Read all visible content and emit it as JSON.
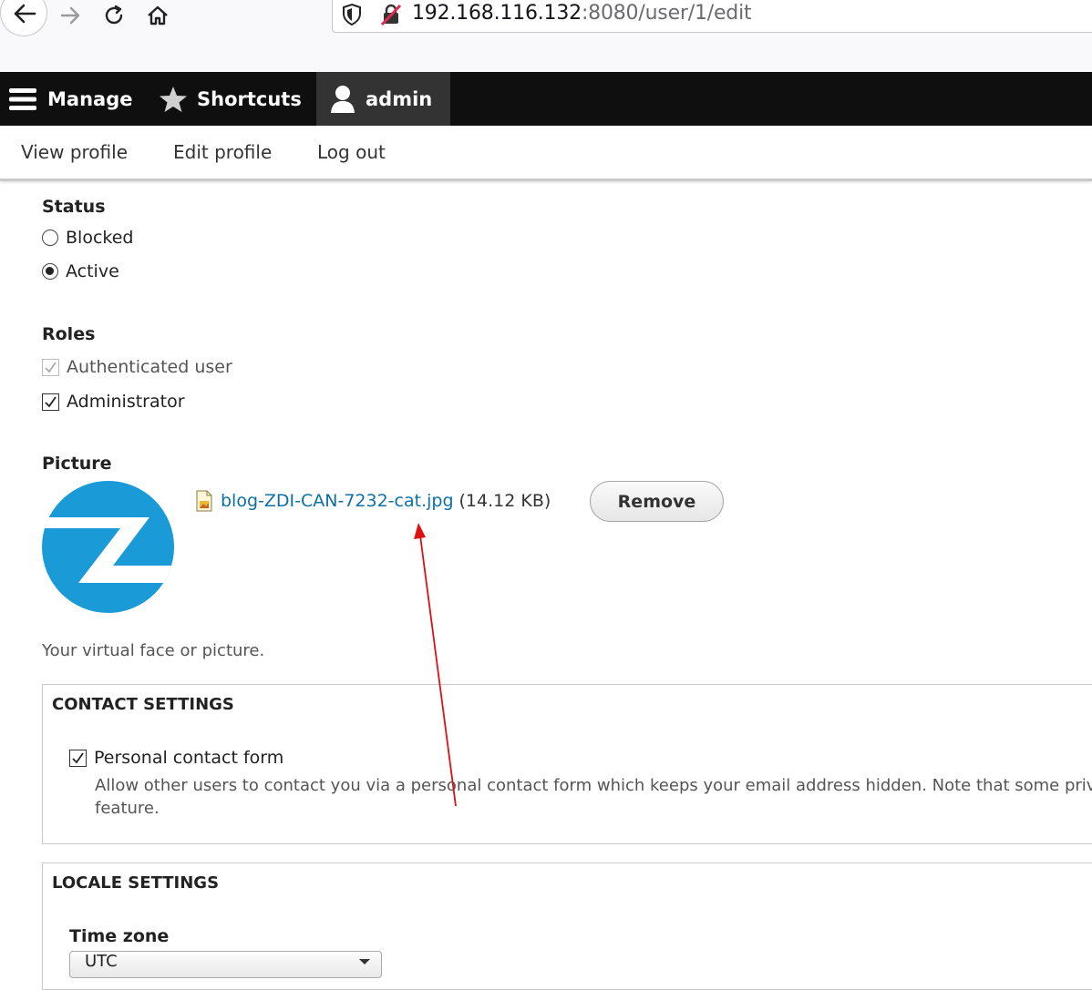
{
  "browser": {
    "url_host": "192.168.116.132",
    "url_path": ":8080/user/1/edit"
  },
  "toolbar": {
    "manage_label": "Manage",
    "shortcuts_label": "Shortcuts",
    "user_label": "admin"
  },
  "tray": {
    "view_profile": "View profile",
    "edit_profile": "Edit profile",
    "log_out": "Log out"
  },
  "status": {
    "label": "Status",
    "options": [
      "Blocked",
      "Active"
    ],
    "selected": "Active"
  },
  "roles": {
    "label": "Roles",
    "options": [
      {
        "label": "Authenticated user",
        "checked": true,
        "disabled": true
      },
      {
        "label": "Administrator",
        "checked": true,
        "disabled": false
      }
    ]
  },
  "picture": {
    "label": "Picture",
    "file_name": "blog-ZDI-CAN-7232-cat.jpg",
    "file_size": "(14.12 KB)",
    "remove_label": "Remove",
    "description": "Your virtual face or picture."
  },
  "contact": {
    "legend": "CONTACT SETTINGS",
    "checkbox_label": "Personal contact form",
    "checked": true,
    "description_line1": "Allow other users to contact you via a personal contact form which keeps your email address hidden. Note that some priv",
    "description_line2": "feature."
  },
  "locale": {
    "legend": "LOCALE SETTINGS",
    "timezone_label": "Time zone",
    "timezone_value": "UTC"
  },
  "colors": {
    "toolbar_bg": "#0f0f0f",
    "link": "#0d6fa8",
    "avatar": "#1a9bd7",
    "annotation_arrow": "#e01010"
  }
}
